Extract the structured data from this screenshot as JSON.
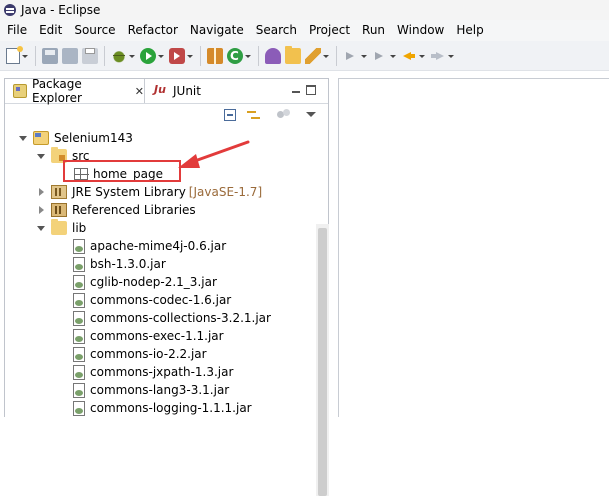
{
  "window": {
    "title": "Java - Eclipse"
  },
  "menu": [
    "File",
    "Edit",
    "Source",
    "Refactor",
    "Navigate",
    "Search",
    "Project",
    "Run",
    "Window",
    "Help"
  ],
  "toolbar": {
    "icons": [
      "new-icon",
      "save-icon",
      "save-all-icon",
      "print-icon",
      "debug-icon",
      "run-icon",
      "external-tools-icon",
      "new-package-icon",
      "new-class-icon",
      "open-type-icon",
      "open-folder-icon",
      "edit-icon",
      "next-annotation-icon",
      "prev-annotation-icon",
      "back-icon",
      "forward-icon"
    ]
  },
  "package_explorer": {
    "tab_label": "Package Explorer",
    "close_symbol": "✕",
    "inactive_tab_label": "JUnit",
    "tree": {
      "project": "Selenium143",
      "src": "src",
      "package": "home_page",
      "jre": "JRE System Library",
      "jre_decor": "[JavaSE-1.7]",
      "referenced": "Referenced Libraries",
      "lib": "lib",
      "jars": [
        "apache-mime4j-0.6.jar",
        "bsh-1.3.0.jar",
        "cglib-nodep-2.1_3.jar",
        "commons-codec-1.6.jar",
        "commons-collections-3.2.1.jar",
        "commons-exec-1.1.jar",
        "commons-io-2.2.jar",
        "commons-jxpath-1.3.jar",
        "commons-lang3-3.1.jar",
        "commons-logging-1.1.1.jar"
      ]
    }
  },
  "colors": {
    "highlight": "#e23b3b",
    "arrow": "#e23b3b",
    "jre_decor": "#9a6a3a"
  }
}
